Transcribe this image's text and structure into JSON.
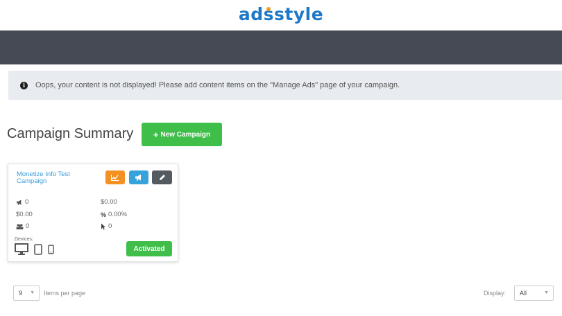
{
  "logo": {
    "part1": "ad",
    "dot_char": "s",
    "part2": "style",
    "accent": "#f0a01e",
    "color": "#1e78c8"
  },
  "alert": {
    "icon": "info-icon",
    "text": "Oops, your content is not displayed! Please add content items on the \"Manage Ads\" page of your campaign."
  },
  "summary": {
    "title": "Campaign Summary",
    "new_button": "New Campaign"
  },
  "campaign": {
    "name": "Monetize Info Test Campaign",
    "metrics": {
      "impressions": "0",
      "revenue": "$0.00",
      "spend": "$0.00",
      "ctr": "0.00%",
      "visitors": "0",
      "clicks": "0"
    },
    "devices_label": "Devices:",
    "status": "Activated",
    "colors": {
      "stats": "#f39223",
      "ads": "#38a3db",
      "edit": "#555960",
      "status": "#3fbe4a"
    }
  },
  "pagination": {
    "per_page_value": "9",
    "per_page_label": "Items per page"
  },
  "display": {
    "label": "Display:",
    "value": "All"
  }
}
